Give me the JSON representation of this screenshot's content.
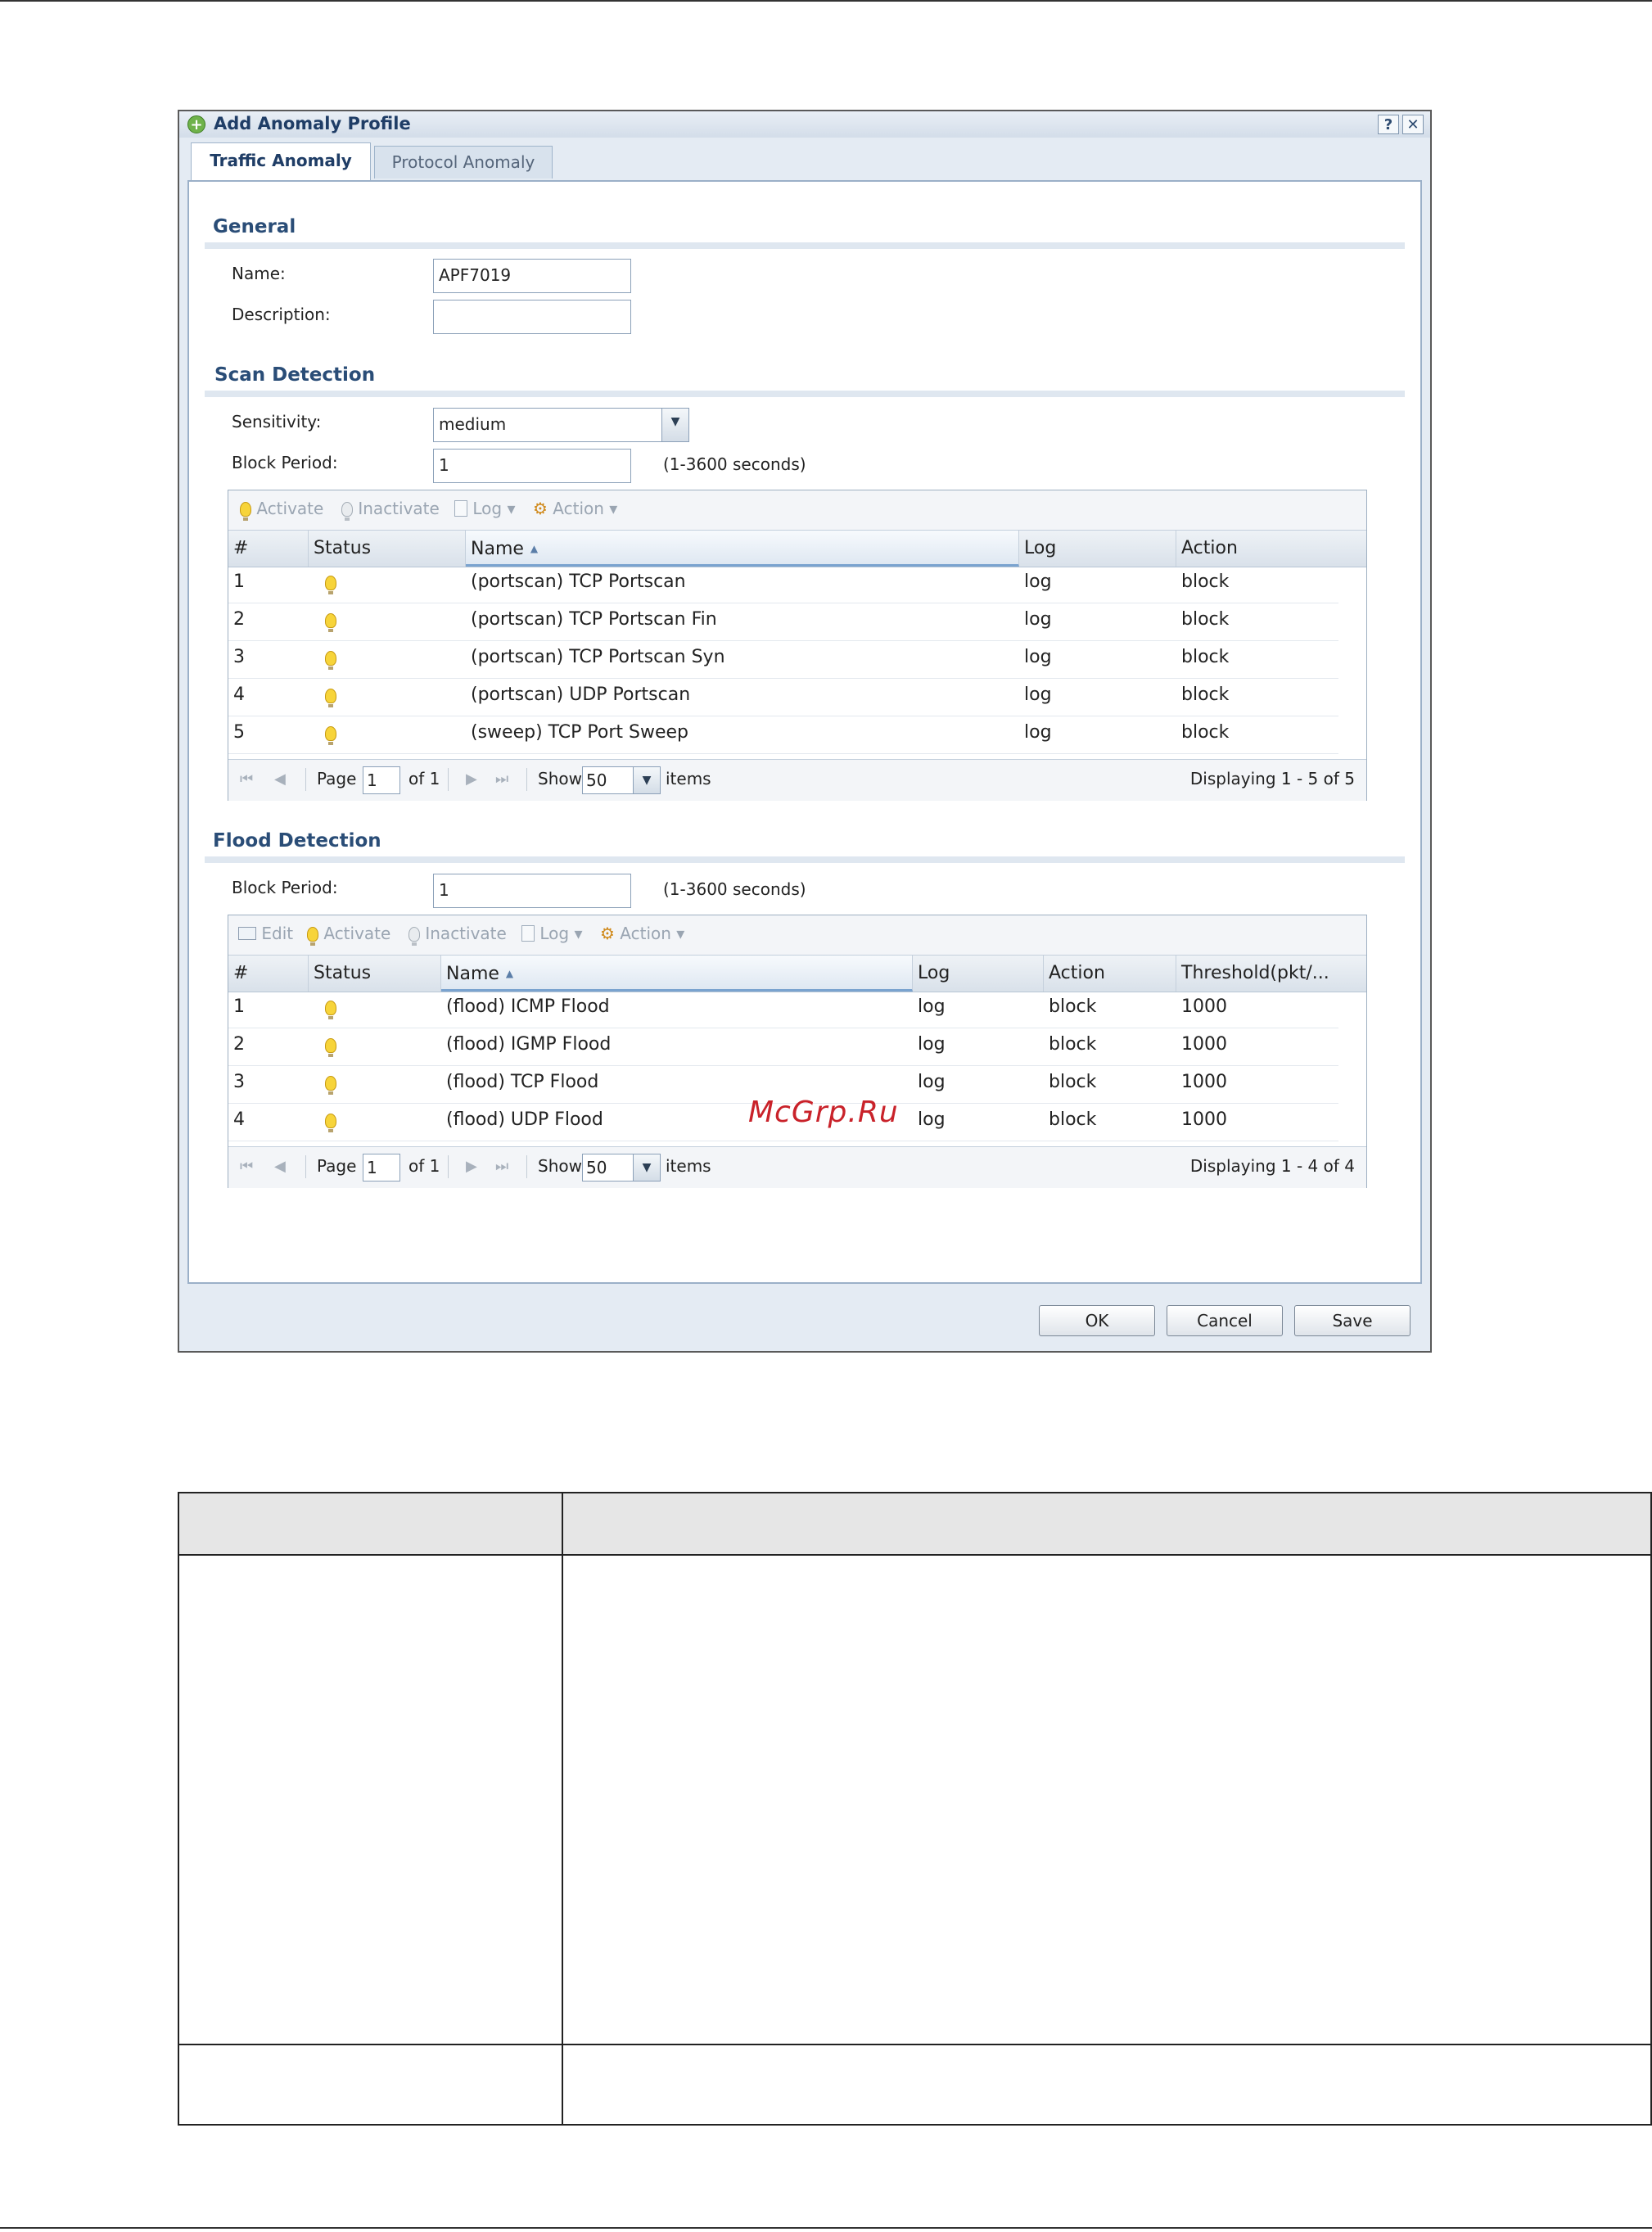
{
  "dialog": {
    "title": "Add Anomaly Profile",
    "help_label": "?",
    "close_label": "✕",
    "tabs": [
      {
        "label": "Traffic Anomaly"
      },
      {
        "label": "Protocol Anomaly"
      }
    ]
  },
  "general": {
    "title": "General",
    "name_label": "Name:",
    "name_value": "APF7019",
    "description_label": "Description:",
    "description_value": ""
  },
  "scan": {
    "title": "Scan Detection",
    "sensitivity_label": "Sensitivity:",
    "sensitivity_value": "medium",
    "block_period_label": "Block Period:",
    "block_period_value": "1",
    "block_period_hint": "(1-3600 seconds)",
    "toolbar": {
      "activate": "Activate",
      "inactivate": "Inactivate",
      "log": "Log",
      "action": "Action"
    },
    "columns": [
      "#",
      "Status",
      "Name",
      "Log",
      "Action"
    ],
    "rows": [
      {
        "num": "1",
        "name": "(portscan) TCP Portscan",
        "log": "log",
        "action": "block"
      },
      {
        "num": "2",
        "name": "(portscan) TCP Portscan Fin",
        "log": "log",
        "action": "block"
      },
      {
        "num": "3",
        "name": "(portscan) TCP Portscan Syn",
        "log": "log",
        "action": "block"
      },
      {
        "num": "4",
        "name": "(portscan) UDP Portscan",
        "log": "log",
        "action": "block"
      },
      {
        "num": "5",
        "name": "(sweep) TCP Port Sweep",
        "log": "log",
        "action": "block"
      }
    ],
    "pager": {
      "page_label": "Page",
      "page_value": "1",
      "of_label": "of 1",
      "show_label": "Show",
      "show_value": "50",
      "items_label": "items",
      "displaying": "Displaying 1 - 5 of 5"
    }
  },
  "flood": {
    "title": "Flood Detection",
    "block_period_label": "Block Period:",
    "block_period_value": "1",
    "block_period_hint": "(1-3600 seconds)",
    "toolbar": {
      "edit": "Edit",
      "activate": "Activate",
      "inactivate": "Inactivate",
      "log": "Log",
      "action": "Action"
    },
    "columns": [
      "#",
      "Status",
      "Name",
      "Log",
      "Action",
      "Threshold(pkt/..."
    ],
    "rows": [
      {
        "num": "1",
        "name": "(flood) ICMP Flood",
        "log": "log",
        "action": "block",
        "threshold": "1000"
      },
      {
        "num": "2",
        "name": "(flood) IGMP Flood",
        "log": "log",
        "action": "block",
        "threshold": "1000"
      },
      {
        "num": "3",
        "name": "(flood) TCP Flood",
        "log": "log",
        "action": "block",
        "threshold": "1000"
      },
      {
        "num": "4",
        "name": "(flood) UDP Flood",
        "log": "log",
        "action": "block",
        "threshold": "1000"
      }
    ],
    "pager": {
      "page_label": "Page",
      "page_value": "1",
      "of_label": "of 1",
      "show_label": "Show",
      "show_value": "50",
      "items_label": "items",
      "displaying": "Displaying 1 - 4 of 4"
    }
  },
  "footer": {
    "ok": "OK",
    "cancel": "Cancel",
    "save": "Save"
  },
  "watermark": "McGrp.Ru"
}
